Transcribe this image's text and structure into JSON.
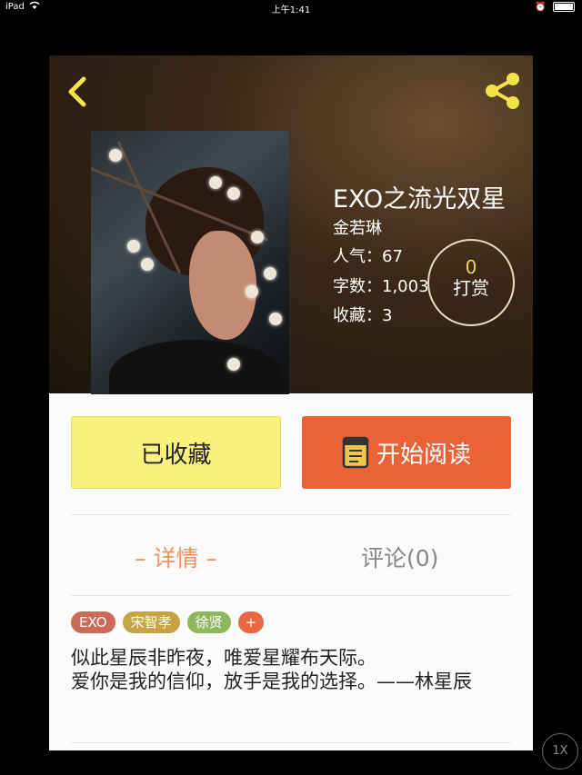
{
  "status_bar": {
    "device": "iPad",
    "time": "上午1:41"
  },
  "book": {
    "title": "EXO之流光双星",
    "author": "金若琳",
    "stats": {
      "popularity": "人气：67",
      "word_count": "字数：1,003",
      "favorites": "收藏：3"
    },
    "reward": {
      "count": "0",
      "label": "打赏"
    }
  },
  "actions": {
    "favorite_label": "已收藏",
    "read_label": "开始阅读"
  },
  "tabs": {
    "detail": "– 详情 –",
    "comment": "评论(0)"
  },
  "tags": [
    "EXO",
    "宋智孝",
    "徐贤"
  ],
  "tag_add": "+",
  "description": "似此星辰非昨夜，唯爱星耀布天际。\n爱你是我的信仰，放手是我的选择。——林星辰",
  "zoom": "1X",
  "colors": {
    "accent_orange": "#ec6238",
    "favorite_yellow": "#fbf27e",
    "tab_active": "#f0915e",
    "icon_yellow": "#f3e24a"
  }
}
